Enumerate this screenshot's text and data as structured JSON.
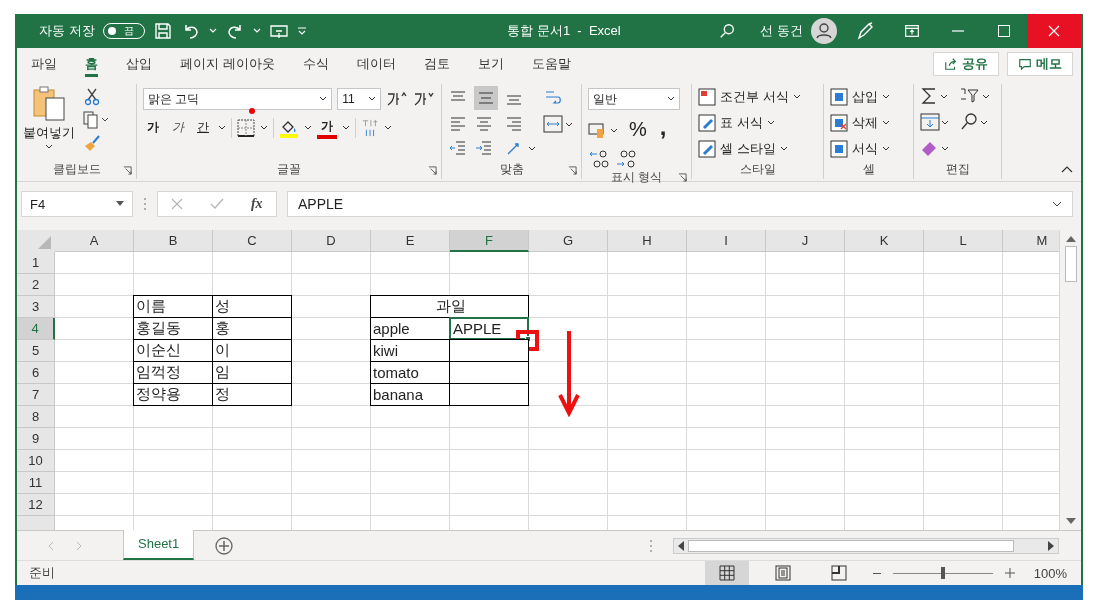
{
  "title_bar": {
    "autosave_label": "자동 저장",
    "autosave": {
      "on": false,
      "label": "끔"
    },
    "title": "통합 문서1  -  Excel",
    "user": "선 동건"
  },
  "ribbon_tabs": [
    {
      "label": "파일",
      "selected": false
    },
    {
      "label": "홈",
      "selected": true
    },
    {
      "label": "삽입",
      "selected": false
    },
    {
      "label": "페이지 레이아웃",
      "selected": false
    },
    {
      "label": "수식",
      "selected": false
    },
    {
      "label": "데이터",
      "selected": false
    },
    {
      "label": "검토",
      "selected": false
    },
    {
      "label": "보기",
      "selected": false
    },
    {
      "label": "도움말",
      "selected": false
    }
  ],
  "share_button": "공유",
  "comments_button": "메모",
  "ribbon": {
    "clipboard": {
      "paste": "붙여넣기",
      "label": "클립보드"
    },
    "font": {
      "name": "맑은 고딕",
      "size": "11",
      "bold": "가",
      "italic": "가",
      "underline": "간",
      "font_color": "가",
      "label": "글꼴"
    },
    "alignment": {
      "label": "맞춤"
    },
    "number": {
      "format": "일반",
      "percent": "%",
      "comma": ",",
      "label": "표시 형식"
    },
    "styles": {
      "items": [
        "조건부 서식",
        "표 서식",
        "셀 스타일"
      ],
      "label": "스타일"
    },
    "cells": {
      "items": [
        "삽입",
        "삭제",
        "서식"
      ],
      "label": "셀"
    },
    "editing": {
      "label": "편집"
    }
  },
  "formula_bar": {
    "name_box": "F4",
    "function_label": "fx",
    "value": "APPLE"
  },
  "sheet": {
    "columns": [
      {
        "label": "A",
        "selected": false
      },
      {
        "label": "B",
        "selected": false
      },
      {
        "label": "C",
        "selected": false
      },
      {
        "label": "D",
        "selected": false
      },
      {
        "label": "E",
        "selected": false
      },
      {
        "label": "F",
        "selected": true
      },
      {
        "label": "G",
        "selected": false
      },
      {
        "label": "H",
        "selected": false
      },
      {
        "label": "I",
        "selected": false
      },
      {
        "label": "J",
        "selected": false
      },
      {
        "label": "K",
        "selected": false
      },
      {
        "label": "L",
        "selected": false
      },
      {
        "label": "M",
        "selected": false
      }
    ],
    "rows": [
      {
        "label": "1",
        "selected": false
      },
      {
        "label": "2",
        "selected": false
      },
      {
        "label": "3",
        "selected": false
      },
      {
        "label": "4",
        "selected": true
      },
      {
        "label": "5",
        "selected": false
      },
      {
        "label": "6",
        "selected": false
      },
      {
        "label": "7",
        "selected": false
      },
      {
        "label": "8",
        "selected": false
      },
      {
        "label": "9",
        "selected": false
      },
      {
        "label": "10",
        "selected": false
      },
      {
        "label": "11",
        "selected": false
      },
      {
        "label": "12",
        "selected": false
      }
    ],
    "tables": [
      {
        "rows": [
          [
            "이름",
            "성"
          ],
          [
            "홍길동",
            "홍"
          ],
          [
            "이순신",
            "이"
          ],
          [
            "임꺽정",
            "임"
          ],
          [
            "정약용",
            "정"
          ]
        ]
      },
      {
        "title": "과일",
        "rows": [
          [
            "apple",
            "APPLE"
          ],
          [
            "kiwi"
          ],
          [
            "tomato"
          ],
          [
            "banana"
          ]
        ]
      }
    ]
  },
  "sheet_tabs": [
    {
      "label": "Sheet1",
      "selected": true
    }
  ],
  "status_bar": {
    "status": "준비",
    "views": [
      {
        "kind": "normal",
        "selected": true
      },
      {
        "kind": "page_layout",
        "selected": false
      },
      {
        "kind": "page_break",
        "selected": false
      }
    ],
    "zoom_slider": {
      "level": 0.5
    },
    "zoom": "100%"
  }
}
